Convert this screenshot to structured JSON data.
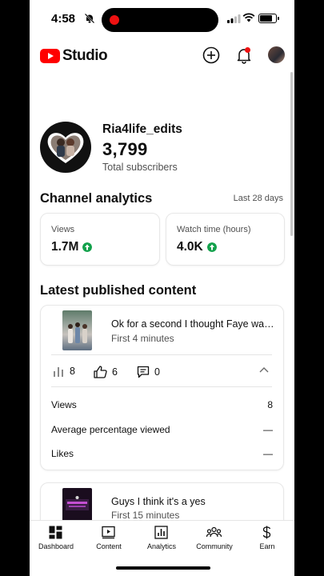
{
  "status_bar": {
    "time": "4:58"
  },
  "app": {
    "logo_text": "Studio",
    "accent": "#ff0000"
  },
  "channel": {
    "name": "Ria4life_edits",
    "subscribers": "3,799",
    "subscribers_label": "Total subscribers"
  },
  "analytics": {
    "title": "Channel analytics",
    "period": "Last 28 days",
    "metrics": [
      {
        "label": "Views",
        "value": "1.7M",
        "trend": "up"
      },
      {
        "label": "Watch time (hours)",
        "value": "4.0K",
        "trend": "up"
      }
    ],
    "trend_color": "#12a14b"
  },
  "latest": {
    "title": "Latest published content",
    "items": [
      {
        "title": "Ok for a second I thought Faye was...",
        "subtitle": "First 4 minutes",
        "views_stat": "8",
        "likes_stat": "6",
        "comments_stat": "0",
        "details": [
          {
            "label": "Views",
            "value": "8"
          },
          {
            "label": "Average percentage viewed",
            "value": "—"
          },
          {
            "label": "Likes",
            "value": "—"
          }
        ]
      },
      {
        "title": "Guys I think it's a yes",
        "subtitle": "First 15 minutes"
      }
    ]
  },
  "nav": {
    "items": [
      {
        "label": "Dashboard",
        "icon": "dashboard-icon",
        "active": true
      },
      {
        "label": "Content",
        "icon": "content-icon"
      },
      {
        "label": "Analytics",
        "icon": "analytics-icon"
      },
      {
        "label": "Community",
        "icon": "community-icon"
      },
      {
        "label": "Earn",
        "icon": "earn-icon"
      }
    ]
  }
}
